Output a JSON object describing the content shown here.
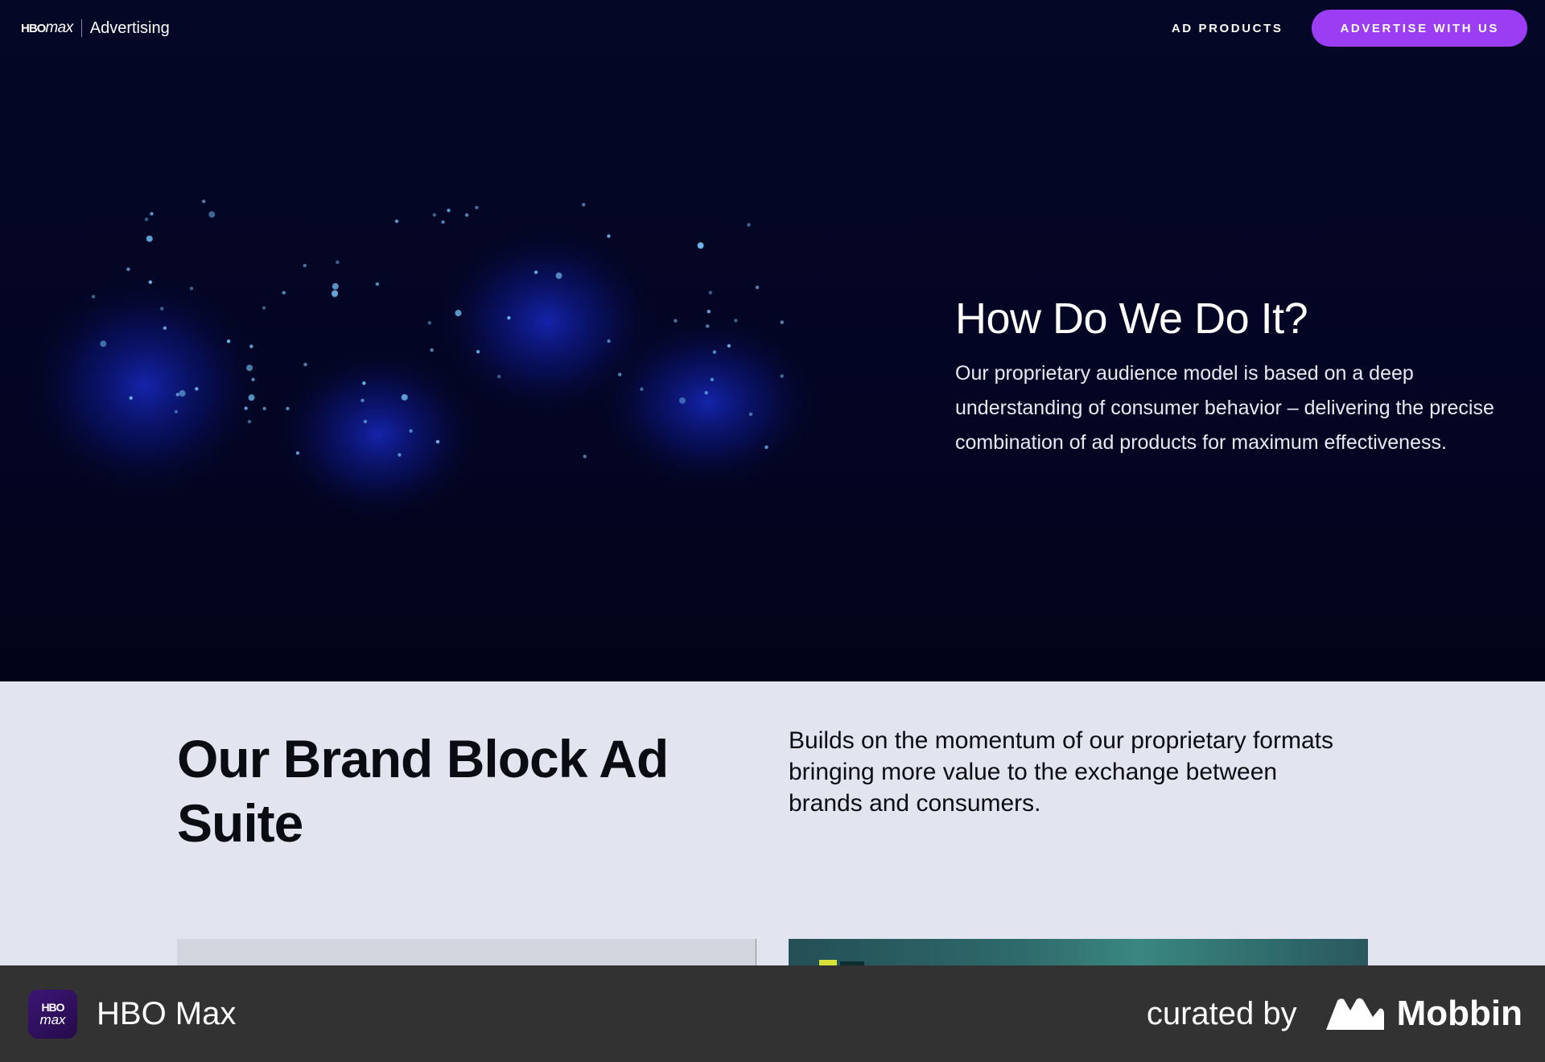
{
  "nav": {
    "brand_logo_hbo": "HBO",
    "brand_logo_max": "max",
    "brand_text": "Advertising",
    "link_ad_products": "AD PRODUCTS",
    "cta_label": "ADVERTISE WITH US"
  },
  "hero": {
    "title": "How Do We Do It?",
    "body": "Our proprietary audience model is based on a deep understanding of consumer behavior – delivering the precise combination of ad products for maximum effectiveness."
  },
  "suite": {
    "title": "Our Brand Block Ad Suite",
    "body": "Builds on the momentum of our proprietary formats bringing more value to the exchange between brands and consumers."
  },
  "footer": {
    "app_icon_line1": "HBO",
    "app_icon_line2": "max",
    "app_name": "HBO Max",
    "curated_label": "curated by",
    "mobbin_label": "Mobbin"
  },
  "colors": {
    "nav_bg": "#050726",
    "hero_bg": "#030523",
    "cta": "#9b3df2",
    "light_section": "#e2e4ef",
    "footer_bg": "#323232"
  }
}
